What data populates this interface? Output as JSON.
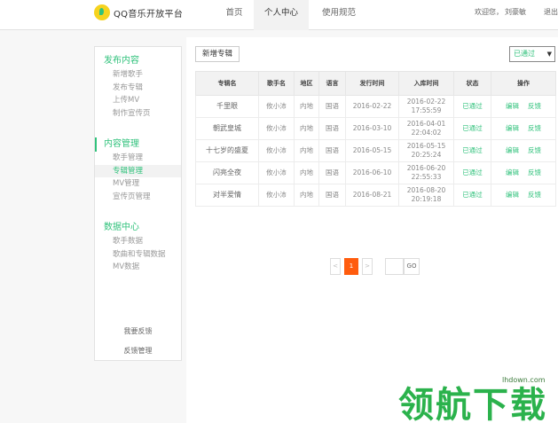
{
  "header": {
    "brand": "QQ音乐开放平台",
    "nav": [
      "首页",
      "个人中心",
      "使用规范"
    ],
    "user": {
      "greeting": "欢迎您，",
      "name": "刘豪敏",
      "logout": "退出"
    }
  },
  "sidebar": {
    "groups": [
      {
        "title": "发布内容",
        "items": [
          "新增歌手",
          "发布专辑",
          "上传MV",
          "制作宣传页"
        ]
      },
      {
        "title": "内容管理",
        "items": [
          "歌手管理",
          "专辑管理",
          "MV管理",
          "宣传页管理"
        ]
      },
      {
        "title": "数据中心",
        "items": [
          "歌手数据",
          "歌曲和专辑数据",
          "MV数据"
        ]
      }
    ],
    "footer": [
      "我要反馈",
      "反馈管理"
    ]
  },
  "toolbar": {
    "add_label": "新增专辑",
    "filter_value": "已通过"
  },
  "table": {
    "headers": [
      "专辑名",
      "歌手名",
      "地区",
      "语言",
      "发行时间",
      "入库时间",
      "状态",
      "操作"
    ],
    "rows": [
      {
        "title": "千里眼",
        "singer": "攸小沛",
        "region": "内地",
        "lang": "国语",
        "release": "2016-02-22",
        "in_date": "2016-02-22",
        "in_time": "17:55:59",
        "status": "已通过"
      },
      {
        "title": "朝武皇城",
        "singer": "攸小沛",
        "region": "内地",
        "lang": "国语",
        "release": "2016-03-10",
        "in_date": "2016-04-01",
        "in_time": "22:04:02",
        "status": "已通过"
      },
      {
        "title": "十七岁的盛夏",
        "singer": "攸小沛",
        "region": "内地",
        "lang": "国语",
        "release": "2016-05-15",
        "in_date": "2016-05-15",
        "in_time": "20:25:24",
        "status": "已通过"
      },
      {
        "title": "闪亮全夜",
        "singer": "攸小沛",
        "region": "内地",
        "lang": "国语",
        "release": "2016-06-10",
        "in_date": "2016-06-20",
        "in_time": "22:55:33",
        "status": "已通过"
      },
      {
        "title": "对半爱情",
        "singer": "攸小沛",
        "region": "内地",
        "lang": "国语",
        "release": "2016-08-21",
        "in_date": "2016-08-20",
        "in_time": "20:19:18",
        "status": "已通过"
      }
    ],
    "ops": [
      "编辑",
      "反馈"
    ]
  },
  "pager": {
    "prev": "<",
    "current": "1",
    "next": ">",
    "go": "GO"
  },
  "watermark": {
    "text": "领航下载",
    "url": "lhdown.com"
  },
  "colors": {
    "accent": "#31c27c",
    "pager_active": "#ff5c0e",
    "watermark": "#2bb24c"
  }
}
